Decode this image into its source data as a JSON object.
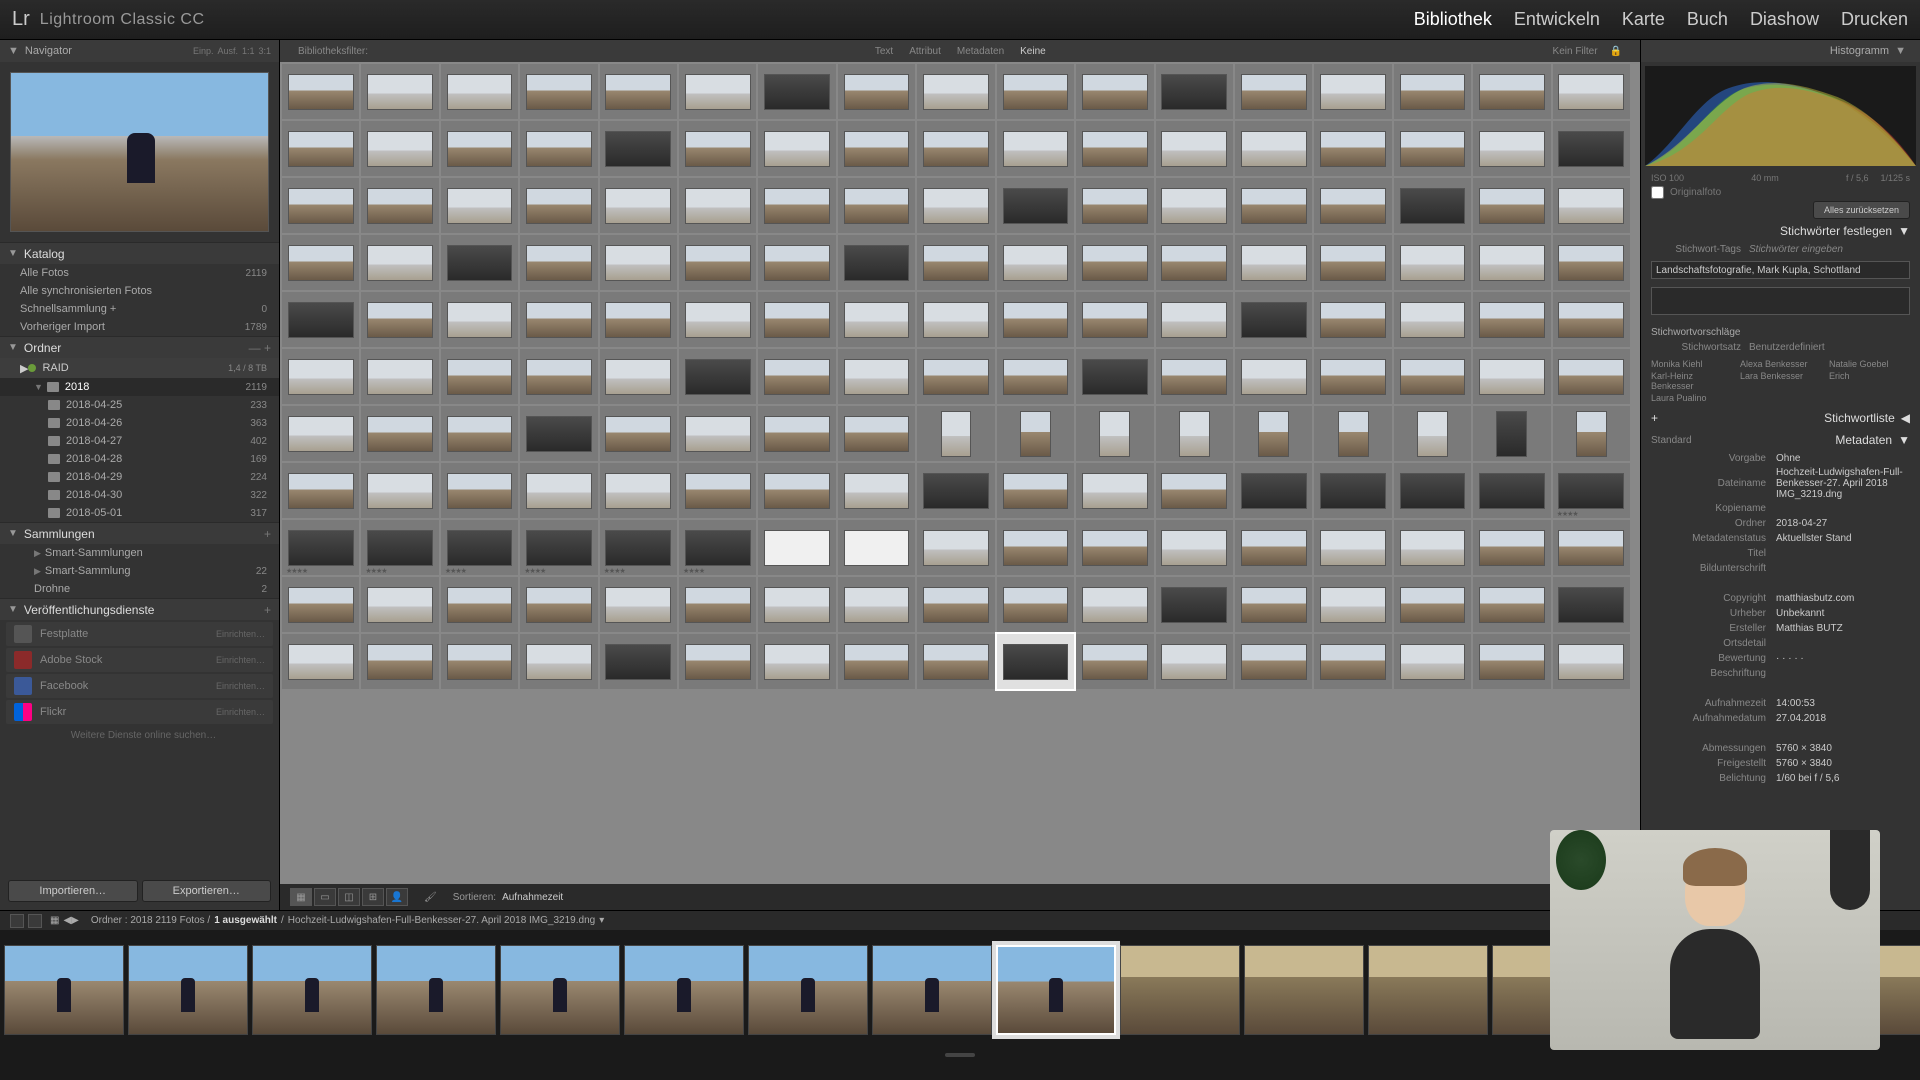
{
  "app": {
    "logo": "Lr",
    "name": "Lightroom Classic CC"
  },
  "modules": [
    "Bibliothek",
    "Entwickeln",
    "Karte",
    "Buch",
    "Diashow",
    "Drucken"
  ],
  "active_module": "Bibliothek",
  "navigator": {
    "title": "Navigator",
    "fit": "Einp.",
    "fill": "Ausf.",
    "r1": "1:1",
    "r2": "3:1"
  },
  "catalog": {
    "title": "Katalog",
    "items": [
      {
        "label": "Alle Fotos",
        "count": "2119"
      },
      {
        "label": "Alle synchronisierten Fotos",
        "count": ""
      },
      {
        "label": "Schnellsammlung  +",
        "count": "0"
      },
      {
        "label": "Vorheriger Import",
        "count": "1789"
      }
    ]
  },
  "folders": {
    "title": "Ordner",
    "drive": {
      "name": "RAID",
      "info": "1,4 / 8 TB"
    },
    "year": {
      "name": "2018",
      "count": "2119"
    },
    "dates": [
      {
        "label": "2018-04-25",
        "count": "233"
      },
      {
        "label": "2018-04-26",
        "count": "363"
      },
      {
        "label": "2018-04-27",
        "count": "402"
      },
      {
        "label": "2018-04-28",
        "count": "169"
      },
      {
        "label": "2018-04-29",
        "count": "224"
      },
      {
        "label": "2018-04-30",
        "count": "322"
      },
      {
        "label": "2018-05-01",
        "count": "317"
      }
    ]
  },
  "collections": {
    "title": "Sammlungen",
    "items": [
      {
        "label": "Smart-Sammlungen",
        "count": ""
      },
      {
        "label": "Smart-Sammlung",
        "count": "22"
      },
      {
        "label": "Drohne",
        "count": "2"
      }
    ]
  },
  "publish": {
    "title": "Veröffentlichungsdienste",
    "services": [
      {
        "label": "Festplatte",
        "setup": "Einrichten…",
        "icon": "hd"
      },
      {
        "label": "Adobe Stock",
        "setup": "Einrichten…",
        "icon": "as"
      },
      {
        "label": "Facebook",
        "setup": "Einrichten…",
        "icon": "fb"
      },
      {
        "label": "Flickr",
        "setup": "Einrichten…",
        "icon": "fl"
      }
    ],
    "more": "Weitere Dienste online suchen…"
  },
  "buttons": {
    "import": "Importieren…",
    "export": "Exportieren…"
  },
  "filterbar": {
    "label": "Bibliotheksfilter:",
    "text": "Text",
    "attr": "Attribut",
    "meta": "Metadaten",
    "none": "Keine",
    "nofilter": "Kein Filter"
  },
  "toolbar": {
    "sort_label": "Sortieren:",
    "sort_value": "Aufnahmezeit"
  },
  "statusbar": {
    "path": "Ordner : 2018   2119 Fotos /",
    "selected": "1 ausgewählt",
    "sep": "/",
    "file": "Hochzeit-Ludwigshafen-Full-Benkesser-27. April 2018 IMG_3219.dng"
  },
  "right": {
    "histogram": "Histogramm",
    "histo_info": {
      "iso": "ISO 100",
      "focal": "40 mm",
      "ap": "f / 5,6",
      "exp": "1/125 s"
    },
    "original": "Originalfoto",
    "reset": "Alles zurücksetzen",
    "keywords_panel": "Stichwörter festlegen",
    "kw_tags_label": "Stichwort-Tags",
    "kw_tags_placeholder": "Stichwörter eingeben",
    "kw_value": "Landschaftsfotografie, Mark Kupla, Schottland",
    "kw_suggest": "Stichwortvorschläge",
    "kw_set_label": "Stichwortsatz",
    "kw_set_value": "Benutzerdefiniert",
    "people": [
      "Monika Kiehl",
      "Alexa Benkesser",
      "Natalie Goebel",
      "Karl-Heinz Benkesser",
      "Lara Benkesser",
      "Erich",
      "Laura Pualino"
    ],
    "kw_list": "Stichwortliste",
    "metadata": "Metadaten",
    "meta_mode": "Standard",
    "vorgabe_label": "Vorgabe",
    "vorgabe_value": "Ohne",
    "meta_rows": [
      {
        "lbl": "Dateiname",
        "val": "Hochzeit-Ludwigshafen-Full-Benkesser-27. April 2018 IMG_3219.dng"
      },
      {
        "lbl": "Kopiename",
        "val": ""
      },
      {
        "lbl": "Ordner",
        "val": "2018-04-27"
      },
      {
        "lbl": "Metadatenstatus",
        "val": "Aktuellster Stand"
      },
      {
        "lbl": "Titel",
        "val": ""
      },
      {
        "lbl": "Bildunterschrift",
        "val": ""
      },
      {
        "lbl": "",
        "val": ""
      },
      {
        "lbl": "Copyright",
        "val": "matthiasbutz.com"
      },
      {
        "lbl": "Urheber",
        "val": "Unbekannt"
      },
      {
        "lbl": "Ersteller",
        "val": "Matthias BUTZ"
      },
      {
        "lbl": "Ortsdetail",
        "val": ""
      },
      {
        "lbl": "Bewertung",
        "val": "·  ·  ·  ·  ·"
      },
      {
        "lbl": "Beschriftung",
        "val": ""
      },
      {
        "lbl": "",
        "val": ""
      },
      {
        "lbl": "Aufnahmezeit",
        "val": "14:00:53"
      },
      {
        "lbl": "Aufnahmedatum",
        "val": "27.04.2018"
      },
      {
        "lbl": "",
        "val": ""
      },
      {
        "lbl": "Abmessungen",
        "val": "5760 × 3840"
      },
      {
        "lbl": "Freigestellt",
        "val": "5760 × 3840"
      },
      {
        "lbl": "Belichtung",
        "val": "1/60 bei f / 5,6"
      }
    ]
  }
}
